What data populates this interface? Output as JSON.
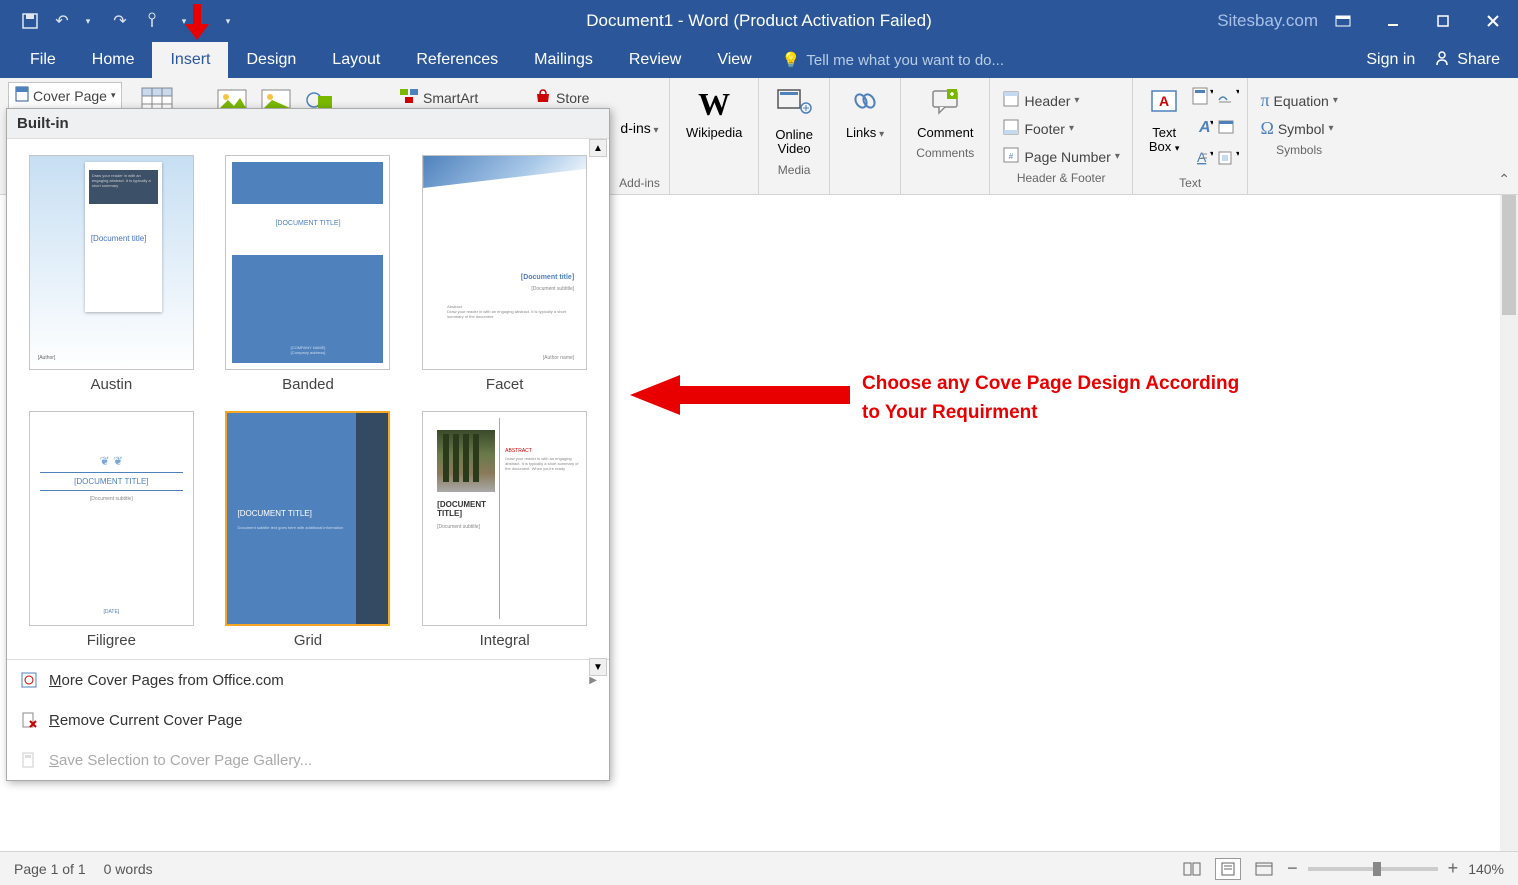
{
  "titlebar": {
    "title": "Document1 - Word (Product Activation Failed)",
    "watermark": "Sitesbay.com"
  },
  "tabs": {
    "file": "File",
    "home": "Home",
    "insert": "Insert",
    "design": "Design",
    "layout": "Layout",
    "references": "References",
    "mailings": "Mailings",
    "review": "Review",
    "view": "View",
    "tellme": "Tell me what you want to do...",
    "signin": "Sign in",
    "share": "Share"
  },
  "ribbon": {
    "coverpage": "Cover Page",
    "smartart": "SmartArt",
    "store": "Store",
    "addins": "d-ins",
    "addins_group": "Add-ins",
    "wikipedia": "Wikipedia",
    "onlinevideo": "Online Video",
    "media": "Media",
    "links": "Links",
    "comment": "Comment",
    "comments": "Comments",
    "header": "Header",
    "footer": "Footer",
    "pagenumber": "Page Number",
    "headerfooter": "Header & Footer",
    "textbox": "Text Box",
    "text_group": "Text",
    "equation": "Equation",
    "symbol": "Symbol",
    "symbols_group": "Symbols"
  },
  "gallery": {
    "header": "Built-in",
    "items": [
      {
        "label": "Austin"
      },
      {
        "label": "Banded"
      },
      {
        "label": "Facet"
      },
      {
        "label": "Filigree"
      },
      {
        "label": "Grid"
      },
      {
        "label": "Integral"
      }
    ],
    "thumb_text": {
      "doc_title": "[Document title]",
      "doc_title_upper": "[DOCUMENT TITLE]",
      "doc_subtitle": "[Document subtitle]",
      "abstract": "Abstract",
      "author": "[Author name]",
      "date": "[DATE]"
    },
    "footer": {
      "more": "More Cover Pages from Office.com",
      "remove": "Remove Current Cover Page",
      "save": "Save Selection to Cover Page Gallery..."
    }
  },
  "annotation": {
    "text": "Choose any Cove Page Design According to Your Requirment"
  },
  "statusbar": {
    "page": "Page 1 of 1",
    "words": "0 words",
    "zoom": "140%"
  }
}
